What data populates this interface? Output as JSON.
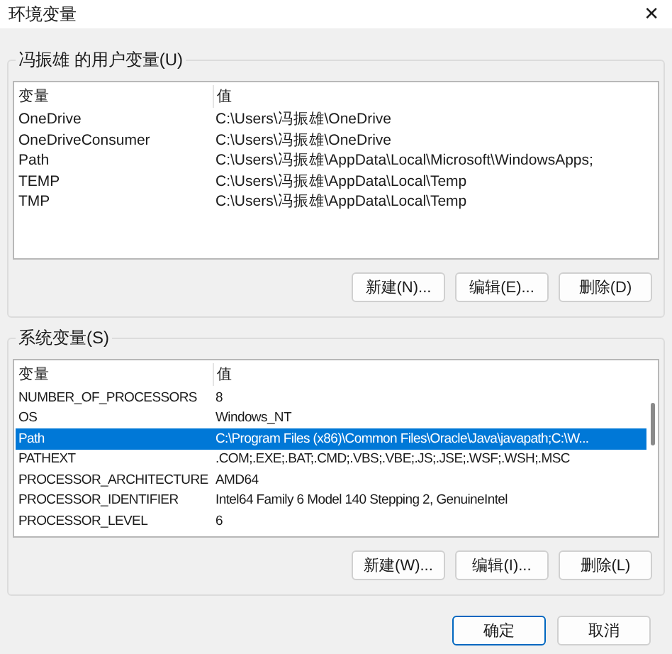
{
  "window": {
    "title": "环境变量",
    "close": "✕"
  },
  "user_variables": {
    "label": "冯振雄 的用户变量(U)",
    "columns": [
      "变量",
      "值"
    ],
    "rows": [
      {
        "name": "OneDrive",
        "value": "C:\\Users\\冯振雄\\OneDrive",
        "selected": false
      },
      {
        "name": "OneDriveConsumer",
        "value": "C:\\Users\\冯振雄\\OneDrive",
        "selected": false
      },
      {
        "name": "Path",
        "value": "C:\\Users\\冯振雄\\AppData\\Local\\Microsoft\\WindowsApps;",
        "selected": false
      },
      {
        "name": "TEMP",
        "value": "C:\\Users\\冯振雄\\AppData\\Local\\Temp",
        "selected": false
      },
      {
        "name": "TMP",
        "value": "C:\\Users\\冯振雄\\AppData\\Local\\Temp",
        "selected": false
      }
    ],
    "buttons": [
      "新建(N)...",
      "编辑(E)...",
      "删除(D)"
    ]
  },
  "system_variables": {
    "label": "系统变量(S)",
    "columns": [
      "变量",
      "值"
    ],
    "rows": [
      {
        "name": "NUMBER_OF_PROCESSORS",
        "value": "8",
        "selected": false
      },
      {
        "name": "OS",
        "value": "Windows_NT",
        "selected": false
      },
      {
        "name": "Path",
        "value": "C:\\Program Files (x86)\\Common Files\\Oracle\\Java\\javapath;C:\\W...",
        "selected": true
      },
      {
        "name": "PATHEXT",
        "value": ".COM;.EXE;.BAT;.CMD;.VBS;.VBE;.JS;.JSE;.WSF;.WSH;.MSC",
        "selected": false
      },
      {
        "name": "PROCESSOR_ARCHITECTURE",
        "value": "AMD64",
        "selected": false
      },
      {
        "name": "PROCESSOR_IDENTIFIER",
        "value": "Intel64 Family 6 Model 140 Stepping 2, GenuineIntel",
        "selected": false
      },
      {
        "name": "PROCESSOR_LEVEL",
        "value": "6",
        "selected": false
      }
    ],
    "buttons": [
      "新建(W)...",
      "编辑(I)...",
      "删除(L)"
    ]
  },
  "dialog_buttons": [
    {
      "label": "确定",
      "default": true
    },
    {
      "label": "取消",
      "default": false
    }
  ]
}
